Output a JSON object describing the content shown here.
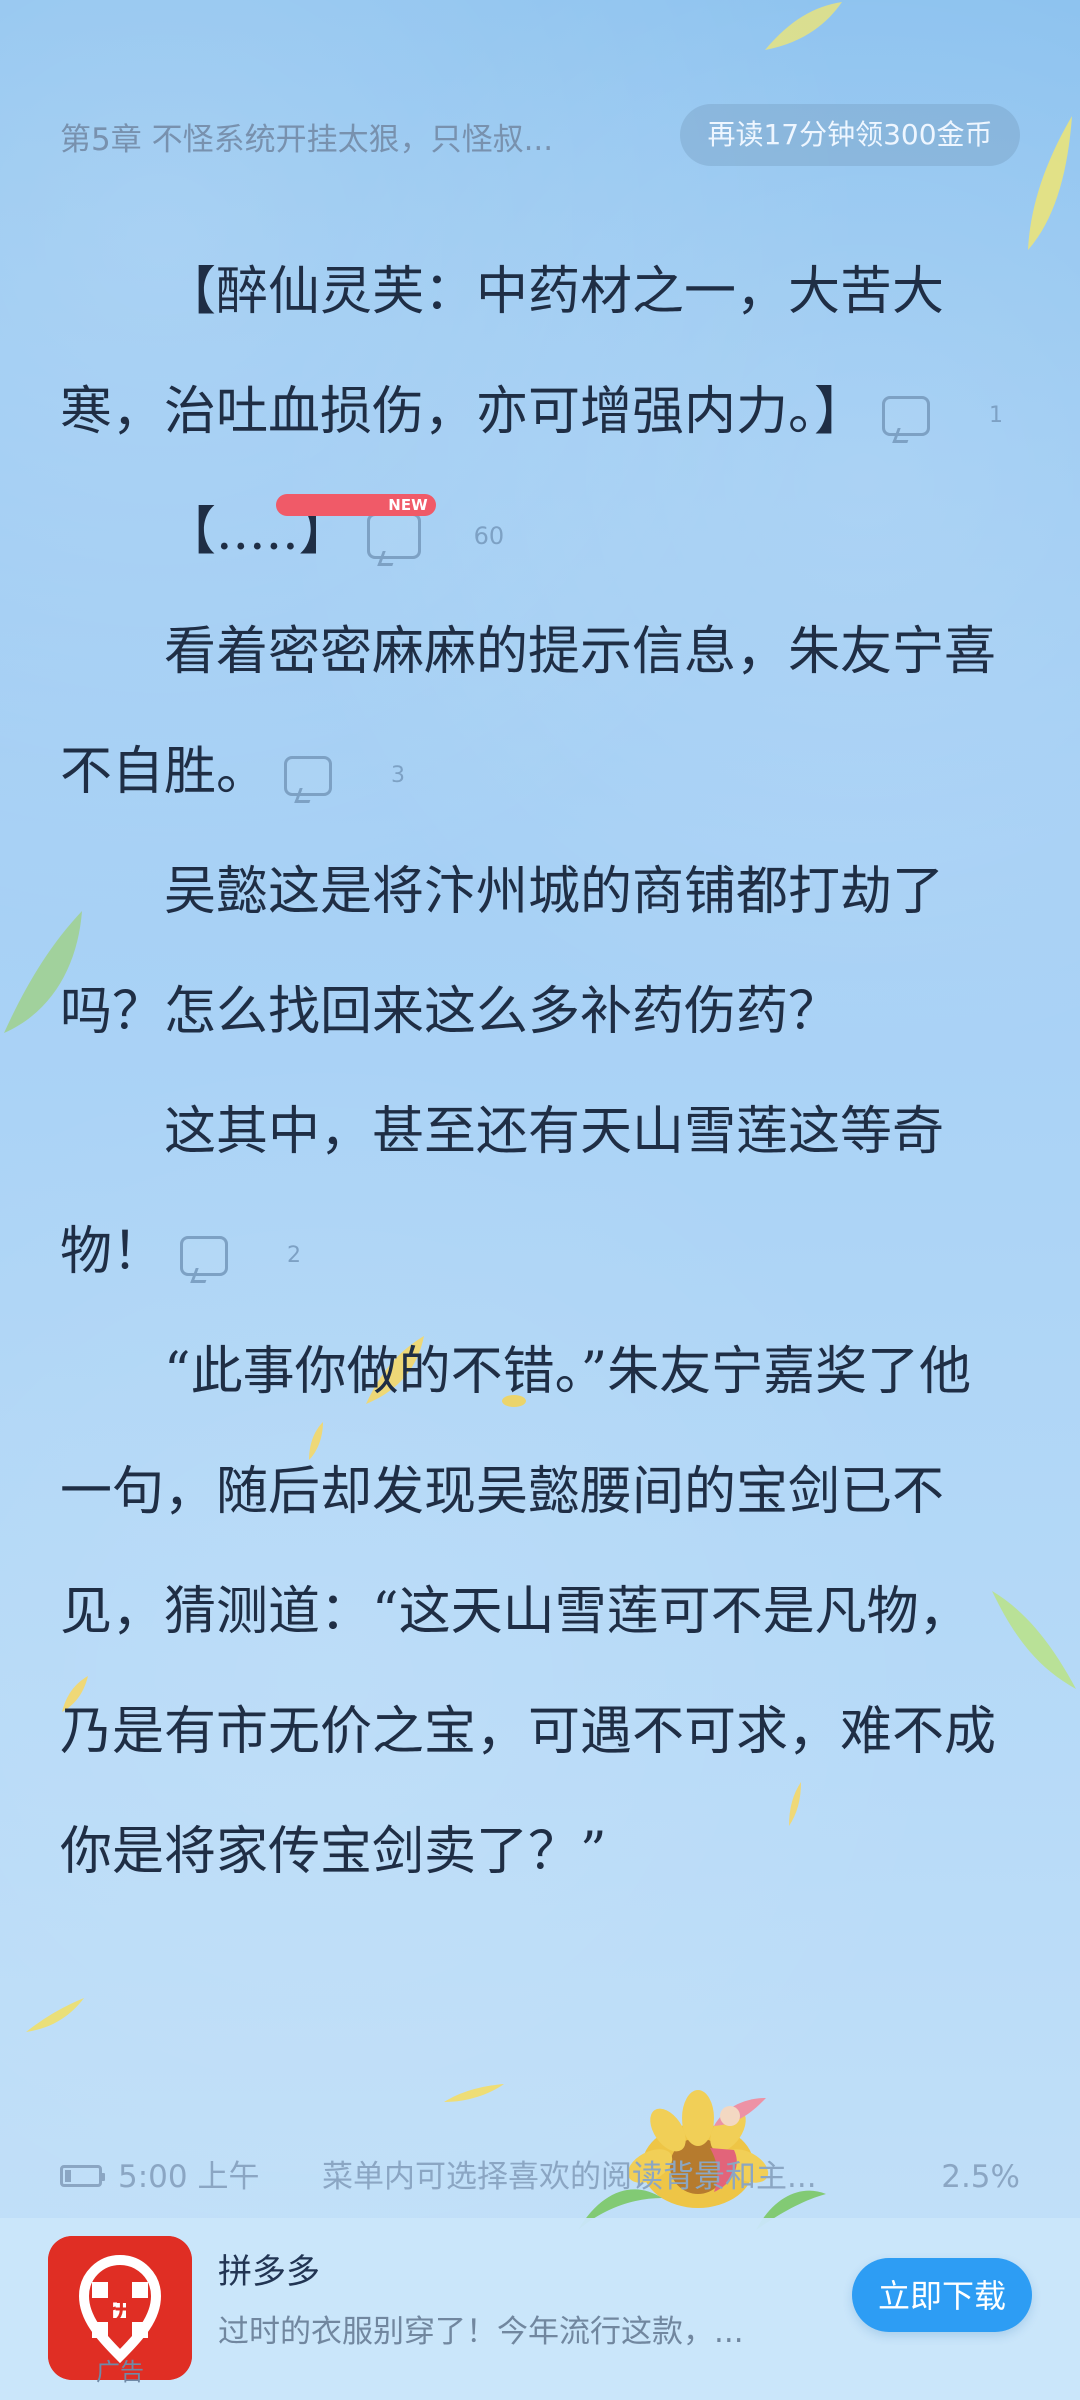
{
  "reader": {
    "chapter_title": "第5章 不怪系统开挂太狠，只怪叔...",
    "reward_pill": "再读17分钟领300金币"
  },
  "content": {
    "paragraphs": [
      {
        "text": "【醉仙灵芙：中药材之一，大苦大寒，治吐血损伤，亦可增强内力。】",
        "comments": "1",
        "comment_icon": "comment-bubble-icon",
        "new_badge": ""
      },
      {
        "text": "【.....】",
        "comments": "60",
        "comment_icon": "comment-bubble-icon",
        "new_badge": "NEW"
      },
      {
        "text": "看着密密麻麻的提示信息，朱友宁喜不自胜。",
        "comments": "3",
        "comment_icon": "comment-bubble-icon",
        "new_badge": ""
      },
      {
        "text": "吴懿这是将汴州城的商铺都打劫了吗？怎么找回来这么多补药伤药？",
        "comments": "",
        "comment_icon": "",
        "new_badge": ""
      },
      {
        "text": "这其中，甚至还有天山雪莲这等奇物！",
        "comments": "2",
        "comment_icon": "comment-bubble-icon",
        "new_badge": ""
      },
      {
        "text": "“此事你做的不错。”朱友宁嘉奖了他一句，随后却发现吴懿腰间的宝剑已不见，猜测道：“这天山雪莲可不是凡物，乃是有市无价之宝，可遇不可求，难不成你是将家传宝剑卖了？”",
        "comments": "",
        "comment_icon": "",
        "new_badge": ""
      }
    ]
  },
  "status": {
    "battery_icon": "battery-icon",
    "time": "5:00 上午",
    "menu_hint": "菜单内可选择喜欢的阅读背景和主...",
    "progress": "2.5%"
  },
  "ad": {
    "logo_icon": "pinduoduo-logo-icon",
    "logo_char": "拼",
    "label": "广告",
    "title": "拼多多",
    "description": "过时的衣服别穿了！今年流行这款，...",
    "button_label": "立即下载"
  },
  "theme": {
    "background_top": "#8cc2ef",
    "background_bottom": "#c4e1f9",
    "text_color": "#1f2e45",
    "accent_blue": "#2d9df4",
    "ad_red": "#e02e24"
  }
}
